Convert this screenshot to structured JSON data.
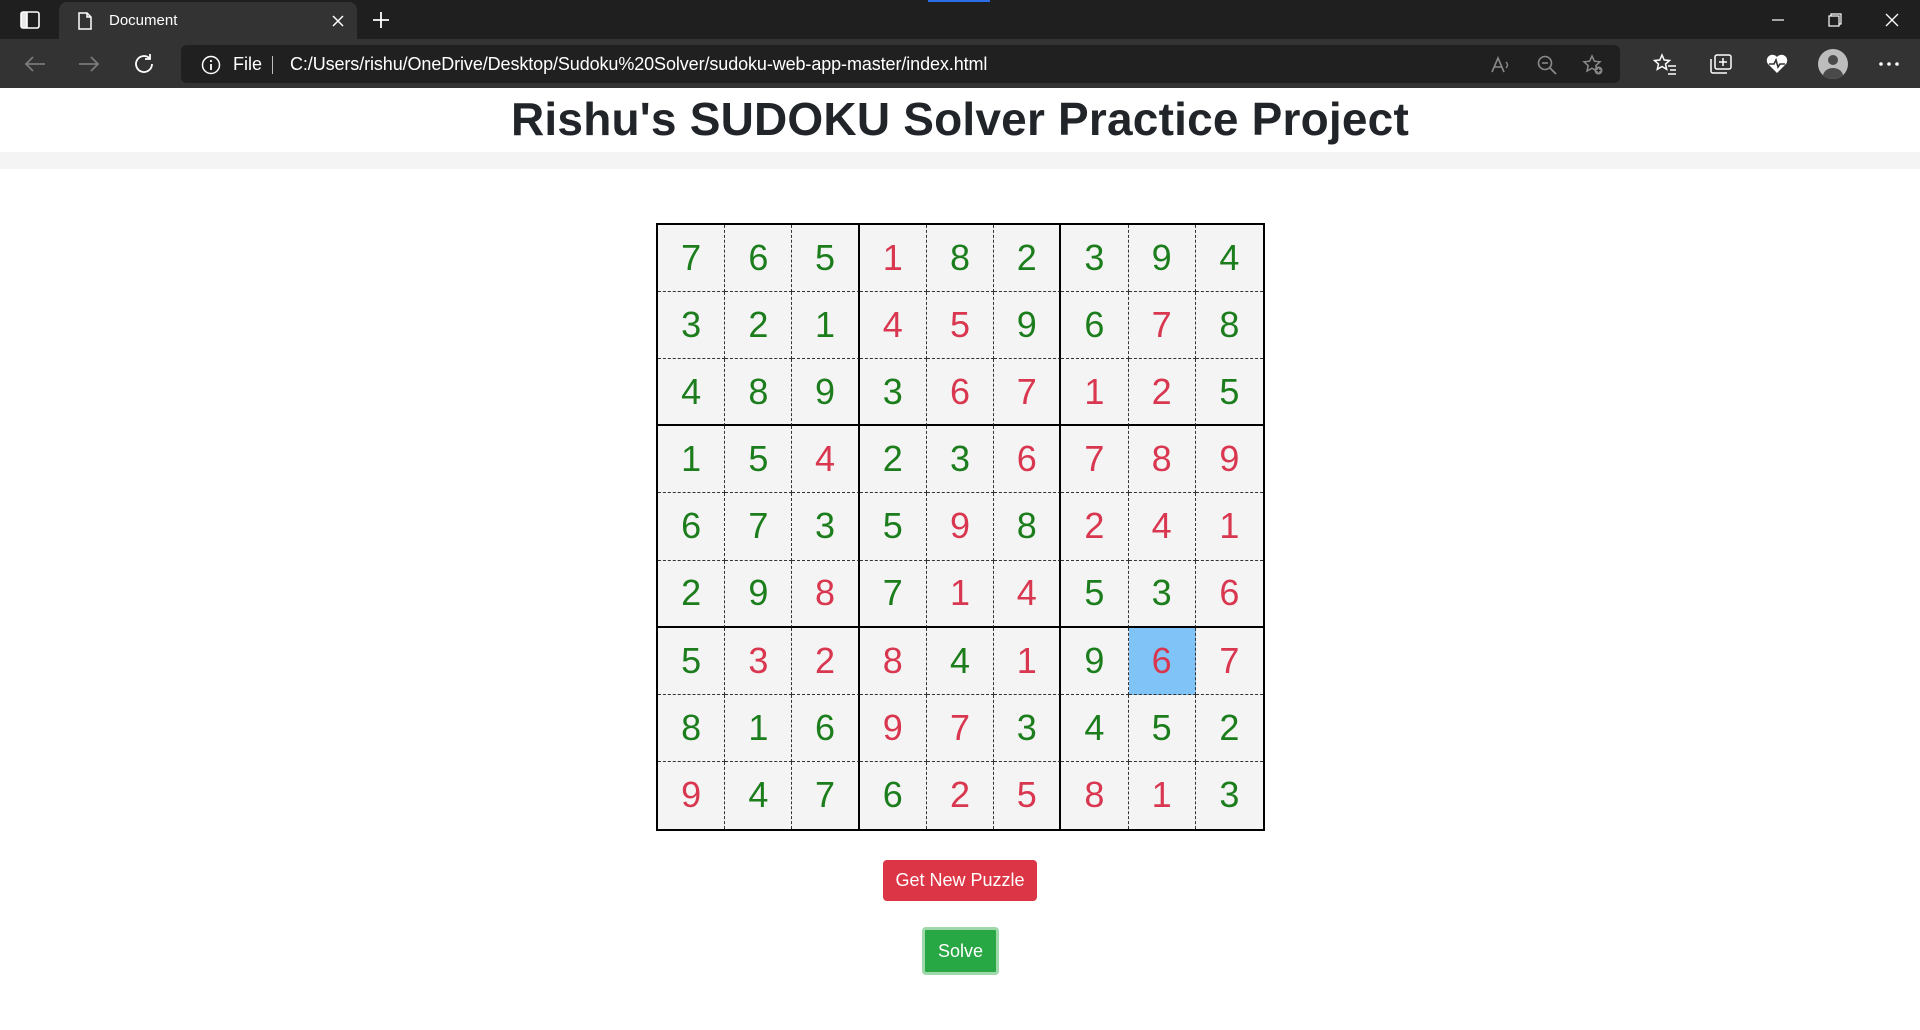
{
  "browser": {
    "tab_title": "Document",
    "address_scheme": "File",
    "address_url": "C:/Users/rishu/OneDrive/Desktop/Sudoku%20Solver/sudoku-web-app-master/index.html",
    "icons": [
      "tab-actions-icon",
      "document-icon",
      "close-icon",
      "plus-icon",
      "minimize-icon",
      "restore-icon",
      "close-window-icon",
      "back-icon",
      "forward-icon",
      "refresh-icon",
      "info-icon",
      "read-aloud-icon",
      "zoom-out-icon",
      "add-favorite-icon",
      "favorites-icon",
      "collections-icon",
      "browser-essentials-icon",
      "profile-avatar",
      "more-menu-icon"
    ]
  },
  "page": {
    "title": "Rishu's SUDOKU Solver Practice Project",
    "new_puzzle_label": "Get New Puzzle",
    "solve_label": "Solve"
  },
  "colors": {
    "given": "#1b7d1b",
    "solved": "#d9364f",
    "selected": "#7fc3f7",
    "new_button": "#dc3545",
    "solve_button": "#28a745"
  },
  "sudoku": {
    "selected_cell": [
      6,
      7
    ],
    "values": [
      [
        7,
        6,
        5,
        1,
        8,
        2,
        3,
        9,
        4
      ],
      [
        3,
        2,
        1,
        4,
        5,
        9,
        6,
        7,
        8
      ],
      [
        4,
        8,
        9,
        3,
        6,
        7,
        1,
        2,
        5
      ],
      [
        1,
        5,
        4,
        2,
        3,
        6,
        7,
        8,
        9
      ],
      [
        6,
        7,
        3,
        5,
        9,
        8,
        2,
        4,
        1
      ],
      [
        2,
        9,
        8,
        7,
        1,
        4,
        5,
        3,
        6
      ],
      [
        5,
        3,
        2,
        8,
        4,
        1,
        9,
        6,
        7
      ],
      [
        8,
        1,
        6,
        9,
        7,
        3,
        4,
        5,
        2
      ],
      [
        9,
        4,
        7,
        6,
        2,
        5,
        8,
        1,
        3
      ]
    ],
    "kinds": [
      [
        "g",
        "g",
        "g",
        "s",
        "g",
        "g",
        "g",
        "g",
        "g"
      ],
      [
        "g",
        "g",
        "g",
        "s",
        "s",
        "g",
        "g",
        "s",
        "g"
      ],
      [
        "g",
        "g",
        "g",
        "g",
        "s",
        "s",
        "s",
        "s",
        "g"
      ],
      [
        "g",
        "g",
        "s",
        "g",
        "g",
        "s",
        "s",
        "s",
        "s"
      ],
      [
        "g",
        "g",
        "g",
        "g",
        "s",
        "g",
        "s",
        "s",
        "s"
      ],
      [
        "g",
        "g",
        "s",
        "g",
        "s",
        "s",
        "g",
        "g",
        "s"
      ],
      [
        "g",
        "s",
        "s",
        "s",
        "g",
        "s",
        "g",
        "s",
        "s"
      ],
      [
        "g",
        "g",
        "g",
        "s",
        "s",
        "g",
        "g",
        "g",
        "g"
      ],
      [
        "s",
        "g",
        "g",
        "g",
        "s",
        "s",
        "s",
        "s",
        "g"
      ]
    ]
  }
}
